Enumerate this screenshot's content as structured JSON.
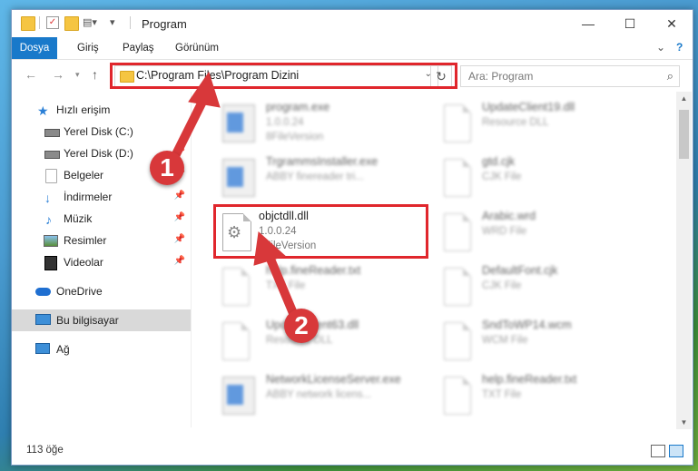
{
  "window": {
    "title": "Program"
  },
  "ribbon": {
    "tabs": [
      {
        "label": "Dosya",
        "active": true
      },
      {
        "label": "Giriş",
        "active": false
      },
      {
        "label": "Paylaş",
        "active": false
      },
      {
        "label": "Görünüm",
        "active": false
      }
    ],
    "help_glyph": "?"
  },
  "address": {
    "path": "C:\\Program Files\\Program Dizini",
    "search_placeholder": "Ara: Program"
  },
  "sidebar": {
    "items": [
      {
        "label": "Hızlı erişim",
        "icon": "star-icon",
        "pinned": false,
        "selected": false
      },
      {
        "label": "Yerel Disk (C:)",
        "icon": "drive-icon",
        "pinned": false,
        "selected": false
      },
      {
        "label": "Yerel Disk (D:)",
        "icon": "drive-icon",
        "pinned": true,
        "selected": false
      },
      {
        "label": "Belgeler",
        "icon": "documents-icon",
        "pinned": true,
        "selected": false
      },
      {
        "label": "İndirmeler",
        "icon": "download-icon",
        "pinned": true,
        "selected": false
      },
      {
        "label": "Müzik",
        "icon": "music-icon",
        "pinned": true,
        "selected": false
      },
      {
        "label": "Resimler",
        "icon": "pictures-icon",
        "pinned": true,
        "selected": false
      },
      {
        "label": "Videolar",
        "icon": "videos-icon",
        "pinned": true,
        "selected": false
      },
      {
        "label": "OneDrive",
        "icon": "onedrive-icon",
        "pinned": false,
        "selected": false
      },
      {
        "label": "Bu bilgisayar",
        "icon": "computer-icon",
        "pinned": false,
        "selected": true
      },
      {
        "label": "Ağ",
        "icon": "network-icon",
        "pinned": false,
        "selected": false
      }
    ]
  },
  "files": [
    {
      "name": "program.exe",
      "line1": "1.0.0.24",
      "line2": "8FileVersion",
      "icon": "app-icon",
      "blurred": true
    },
    {
      "name": "UpdateClient19.dll",
      "line1": "Resource DLL",
      "line2": "",
      "icon": "dll-icon",
      "blurred": true
    },
    {
      "name": "TrgrammsInstaller.exe",
      "line1": "ABBY finereader tri...",
      "line2": "",
      "icon": "app-icon",
      "blurred": true
    },
    {
      "name": "gtd.cjk",
      "line1": "CJK File",
      "line2": "",
      "icon": "doc-icon",
      "blurred": true
    },
    {
      "name": "objctdll.dll",
      "line1": "1.0.0.24",
      "line2": "8FileVersion",
      "icon": "dll-icon",
      "blurred": false
    },
    {
      "name": "Arabic.wrd",
      "line1": "WRD File",
      "line2": "",
      "icon": "doc-icon",
      "blurred": true
    },
    {
      "name": "help.fineReader.txt",
      "line1": "TXT File",
      "line2": "",
      "icon": "doc-icon",
      "blurred": true
    },
    {
      "name": "DefaultFont.cjk",
      "line1": "CJK File",
      "line2": "",
      "icon": "doc-icon",
      "blurred": true
    },
    {
      "name": "UpdateClient63.dll",
      "line1": "Resource DLL",
      "line2": "",
      "icon": "dll-icon",
      "blurred": true
    },
    {
      "name": "SndToWP14.wcm",
      "line1": "WCM File",
      "line2": "",
      "icon": "doc-icon",
      "blurred": true
    },
    {
      "name": "NetworkLicenseServer.exe",
      "line1": "ABBY network licens...",
      "line2": "",
      "icon": "app-icon",
      "blurred": true
    },
    {
      "name": "help.fineReader.txt",
      "line1": "TXT File",
      "line2": "",
      "icon": "doc-icon",
      "blurred": true
    }
  ],
  "status": {
    "count": "113 öğe"
  },
  "callouts": [
    "1",
    "2"
  ],
  "colors": {
    "accent": "#1979ca",
    "highlight": "#e0262c",
    "callout": "#d8383a"
  }
}
